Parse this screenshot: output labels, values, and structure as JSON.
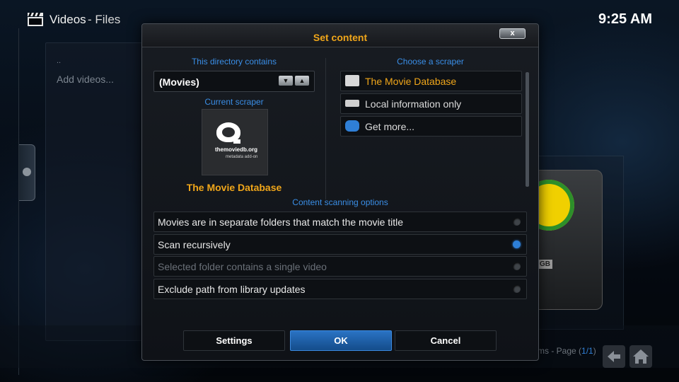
{
  "header": {
    "title": "Videos",
    "subtitle": "- Files",
    "clock": "9:25 AM",
    "icon": "clapperboard-icon"
  },
  "file_list": {
    "parent_item": "..",
    "add_item": "Add videos..."
  },
  "footer": {
    "page_prefix": "ms - Page (",
    "page_num": "1/1",
    "page_suffix": ")",
    "back_icon": "arrow-left-icon",
    "home_icon": "home-icon"
  },
  "background_art": {
    "drive_label": "GB"
  },
  "dialog": {
    "title": "Set content",
    "close_label": "x",
    "directory_contains_label": "This directory contains",
    "directory_value": "(Movies)",
    "spinner_down": "▼",
    "spinner_up": "▲",
    "current_scraper_label": "Current scraper",
    "current_scraper_name": "The Movie Database",
    "logo_text": "themoviedb.org",
    "logo_subtext": "metadata add-on",
    "choose_scraper_label": "Choose a scraper",
    "scrapers": [
      {
        "label": "The Movie Database",
        "selected": true,
        "icon": "tmdb-icon"
      },
      {
        "label": "Local information only",
        "selected": false,
        "icon": "nfo-icon"
      },
      {
        "label": "Get more...",
        "selected": false,
        "icon": "puzzle-piece-icon"
      }
    ],
    "scan_options_label": "Content scanning options",
    "options": [
      {
        "label": "Movies are in separate folders that match the movie title",
        "enabled": true,
        "on": false
      },
      {
        "label": "Scan recursively",
        "enabled": true,
        "on": true
      },
      {
        "label": "Selected folder contains a single video",
        "enabled": false,
        "on": false
      },
      {
        "label": "Exclude path from library updates",
        "enabled": true,
        "on": false
      }
    ],
    "buttons": {
      "settings": "Settings",
      "ok": "OK",
      "cancel": "Cancel"
    }
  },
  "colors": {
    "accent_orange": "#f0a61a",
    "accent_blue": "#3a8ee6",
    "focus_blue": "#2a73c4"
  }
}
